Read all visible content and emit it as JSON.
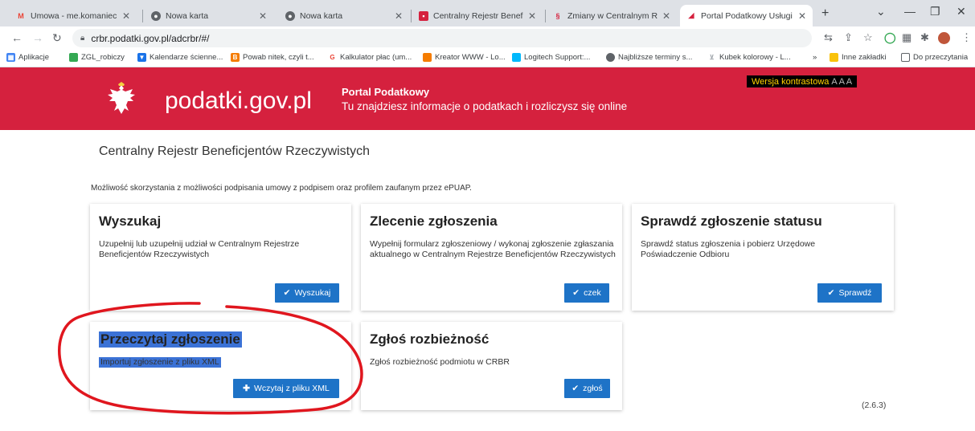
{
  "browser": {
    "tabs": [
      {
        "title": "Umowa - me.komaniecka@",
        "icon": "gmail-icon"
      },
      {
        "title": "Nowa karta",
        "icon": "chrome-icon"
      },
      {
        "title": "Nowa karta",
        "icon": "chrome-icon"
      },
      {
        "title": "Centralny Rejestr Beneficjen",
        "icon": "crbr-icon"
      },
      {
        "title": "Zmiany w Centralnym Rejes",
        "icon": "paragraph-icon"
      },
      {
        "title": "Portal Podatkowy Usługi - ",
        "icon": "podatki-icon"
      }
    ],
    "url": "crbr.podatki.gov.pl/adcrbr/#/",
    "bookmarks": [
      {
        "label": "Aplikacje",
        "color": "#4285f4"
      },
      {
        "label": "ZGL_robiczy",
        "color": "#34a853"
      },
      {
        "label": "Kalendarze ścienne...",
        "color": "#1a73e8"
      },
      {
        "label": "Powab nitek, czyli t...",
        "color": "#f57c00"
      },
      {
        "label": "Kalkulator płac (um...",
        "color": "#ea4335"
      },
      {
        "label": "Kreator WWW - Lo...",
        "color": "#f57c00"
      },
      {
        "label": "Logitech Support:...",
        "color": "#00b8fc"
      },
      {
        "label": "Najbliższe terminy s...",
        "color": "#5f6368"
      },
      {
        "label": "Kubek kolorowy - L...",
        "color": "#9aa0a6"
      }
    ],
    "other_bookmarks": "Inne zakładki",
    "reading_list": "Do przeczytania",
    "overflow": "»"
  },
  "site": {
    "brand": "podatki.gov.pl",
    "portal_title": "Portal Podatkowy",
    "portal_subtitle": "Tu znajdziesz informacje o podatkach i rozliczysz się online",
    "contrast_label": "Wersja kontrastowa",
    "contrast_letters": "A A A"
  },
  "main": {
    "page_title": "Centralny Rejestr Beneficjentów Rzeczywistych",
    "note": "Możliwość skorzystania z możliwości podpisania umowy z podpisem oraz profilem zaufanym przez ePUAP.",
    "cards": [
      {
        "title": "Wyszukaj",
        "desc": "Uzupełnij lub uzupełnij udział w Centralnym Rejestrze Beneficjentów Rzeczywistych",
        "button": "Wyszukaj",
        "button_icon": "check-icon"
      },
      {
        "title": "Zlecenie zgłoszenia",
        "desc": "Wypełnij formularz zgłoszeniowy / wykonaj zgłoszenie zgłaszania aktualnego w Centralnym Rejestrze Beneficjentów Rzeczywistych",
        "button": "czek",
        "button_icon": "check-icon"
      },
      {
        "title": "Sprawdź zgłoszenie statusu",
        "desc": "Sprawdź status zgłoszenia i pobierz Urzędowe Poświadczenie Odbioru",
        "button": "Sprawdź",
        "button_icon": "check-icon"
      },
      {
        "title": "Przeczytaj zgłoszenie",
        "desc": "Importuj zgłoszenie z pliku XML",
        "button": "Wczytaj z pliku XML",
        "button_icon": "plus-icon"
      },
      {
        "title": "Zgłoś rozbieżność",
        "desc": "Zgłoś rozbieżność podmiotu w CRBR",
        "button": "zgłoś",
        "button_icon": "check-icon"
      }
    ],
    "version": "(2.6.3)"
  },
  "colors": {
    "brand_red": "#d5213e",
    "button_blue": "#1e73c7",
    "annotation_red": "#e0161e",
    "selection": "#3b72d6"
  }
}
